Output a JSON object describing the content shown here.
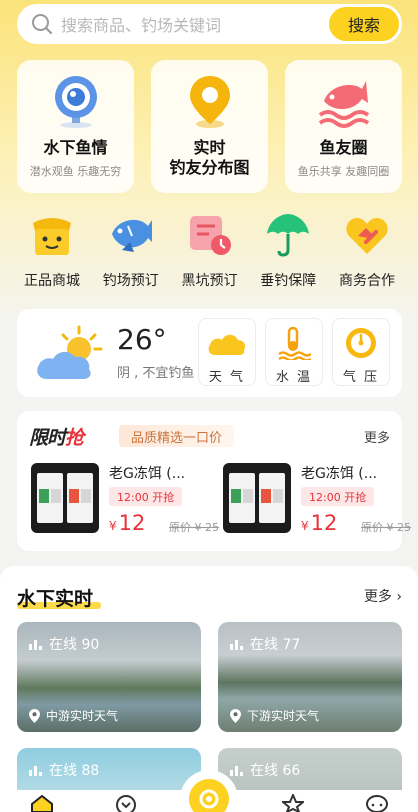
{
  "search": {
    "placeholder": "搜索商品、钓场关键词",
    "button_label": "搜索"
  },
  "features": [
    {
      "title": "水下鱼情",
      "subtitle": "潜水观鱼  乐趣无穷",
      "icon": "camera-icon"
    },
    {
      "title": "实时\n钓友分布图",
      "subtitle": "",
      "icon": "location-pin-icon"
    },
    {
      "title": "鱼友圈",
      "subtitle": "鱼乐共享  友趣同圈",
      "icon": "fish-icon"
    }
  ],
  "quick_links": [
    {
      "label": "正品商城",
      "icon": "shop-icon"
    },
    {
      "label": "钓场预订",
      "icon": "fish-booking-icon"
    },
    {
      "label": "黑坑预订",
      "icon": "calendar-clock-icon"
    },
    {
      "label": "垂钓保障",
      "icon": "umbrella-icon"
    },
    {
      "label": "商务合作",
      "icon": "handshake-heart-icon"
    }
  ],
  "weather": {
    "temperature": "26°",
    "description": "阴 , 不宜钓鱼",
    "metrics": [
      {
        "label": "天 气",
        "icon": "cloud-icon"
      },
      {
        "label": "水 温",
        "icon": "water-temperature-icon"
      },
      {
        "label": "气 压",
        "icon": "pressure-gauge-icon"
      }
    ]
  },
  "flash_sale": {
    "logo_black": "限时",
    "logo_red": "抢",
    "tag": "品质精选一口价",
    "more": "更多",
    "products": [
      {
        "name": "老G冻饵 (...",
        "time": "12:00 开抢",
        "currency": "¥",
        "price": "12",
        "original": "原价 ¥ 25"
      },
      {
        "name": "老G冻饵 (...",
        "time": "12:00 开抢",
        "currency": "¥",
        "price": "12",
        "original": "原价 ¥ 25"
      }
    ]
  },
  "live": {
    "title": "水下实时",
    "more": "更多",
    "cards": [
      {
        "online": "在线 90",
        "location": "中游实时天气"
      },
      {
        "online": "在线 77",
        "location": "下游实时天气"
      },
      {
        "online": "在线 88",
        "location": ""
      },
      {
        "online": "在线 66",
        "location": ""
      }
    ]
  },
  "colors": {
    "accent": "#fcd11f",
    "price_red": "#e8323b"
  }
}
